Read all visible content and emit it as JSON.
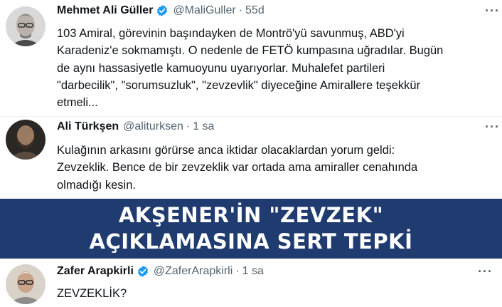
{
  "tweets": [
    {
      "name": "Mehmet Ali Güller",
      "handle": "@MaliGuller",
      "time": "55d",
      "verified": true,
      "more": "···",
      "lines": [
        "103 Amiral, görevinin başındayken de Montrö'yü savunmuş, ABD'yi",
        "Karadeniz'e sokmamıştı. O nedenle de FETÖ kumpasına uğradılar. Bugün",
        "de aynı hassasiyetle kamuoyunu uyarıyorlar. Muhalefet partileri",
        "\"darbecilik\", \"sorumsuzluk\", \"zevzevlik\" diyeceğine Amirallere teşekkür",
        "etmeli..."
      ]
    },
    {
      "name": "Ali Türkşen",
      "handle": "@aliturksen",
      "time": "1 sa",
      "verified": false,
      "more": "···",
      "lines": [
        "Kulağının arkasını görürse anca iktidar olacaklardan yorum geldi:",
        "Zevzeklik. Bence de bir zevzeklik var ortada ama amiraller cenahında",
        "olmadığı kesin."
      ]
    },
    {
      "name": "Zafer Arapkirli",
      "handle": "@ZaferArapkirli",
      "time": "1 sa",
      "verified": true,
      "more": "···",
      "lines": [
        "ZEVZEKLİK?"
      ]
    }
  ],
  "banner": {
    "line1": "AKŞENER'İN \"ZEVZEK\"",
    "line2": "AÇIKLAMASINA SERT TEPKİ"
  },
  "colors": {
    "banner_bg": "#1f3b6f",
    "verified_blue": "#1d9bf0",
    "muted": "#536471"
  },
  "icons": {
    "verified": "verified-badge-icon",
    "more": "more-options-icon"
  }
}
